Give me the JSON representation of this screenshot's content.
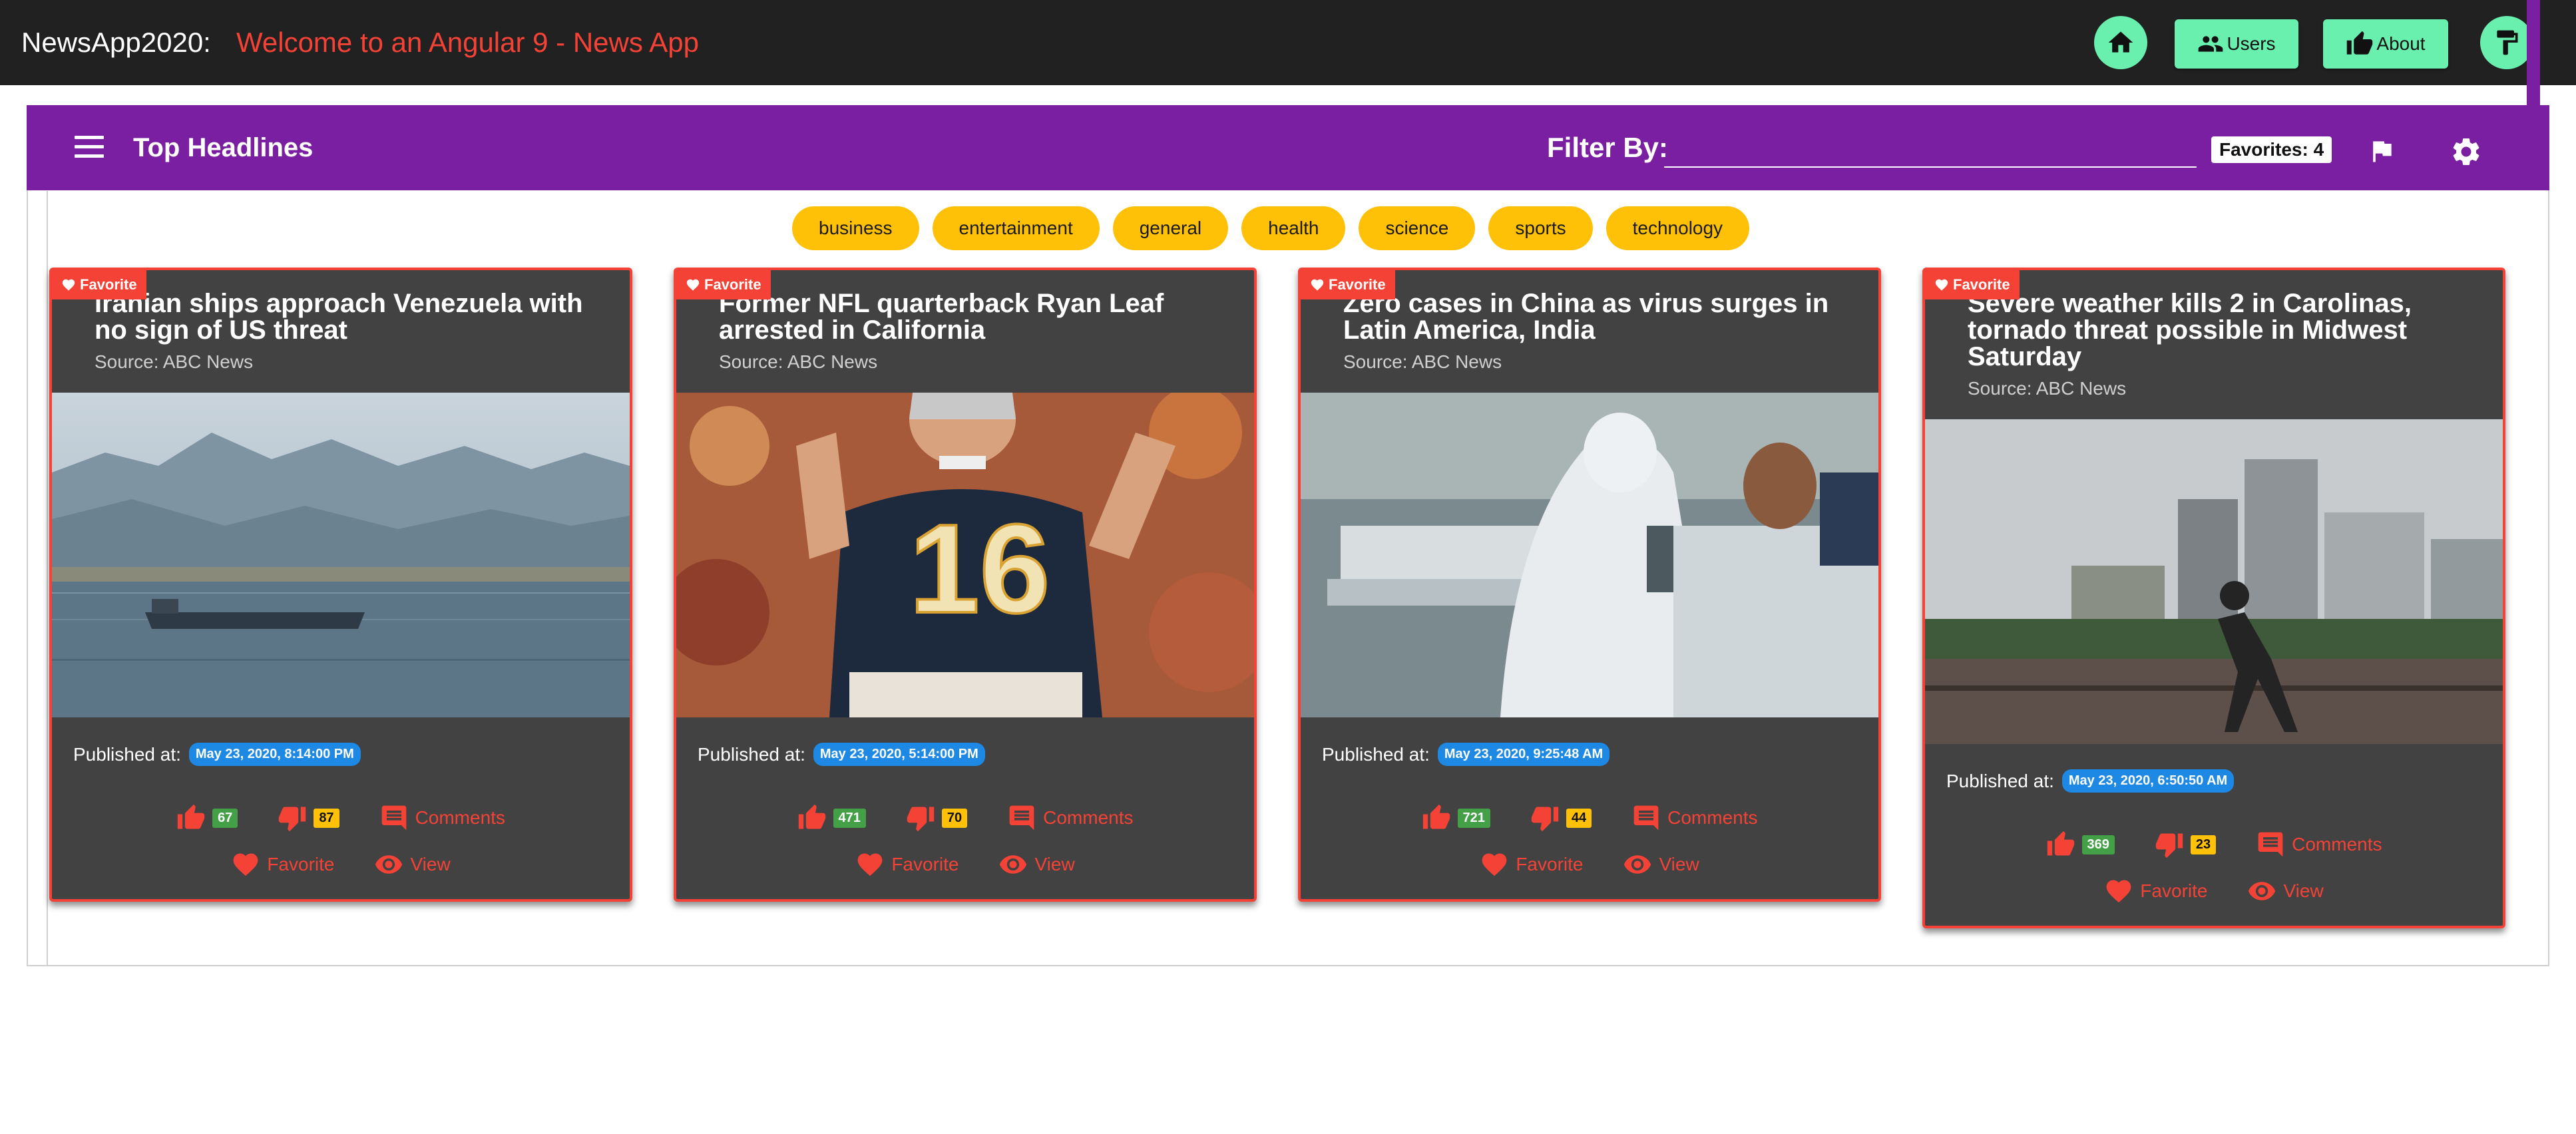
{
  "app": {
    "brand": "NewsApp2020:",
    "welcome": "Welcome to an Angular 9 - News App",
    "nav": {
      "users": "Users",
      "about": "About"
    },
    "colors": {
      "toolbar": "#212121",
      "accent": "#69f0ae",
      "primary": "#7b1fa2",
      "warn": "#f44336",
      "chip": "#ffc107"
    }
  },
  "header": {
    "title": "Top Headlines",
    "filter_label": "Filter By:",
    "filter_value": "",
    "favorites": "Favorites: 4"
  },
  "categories": [
    "business",
    "entertainment",
    "general",
    "health",
    "science",
    "sports",
    "technology"
  ],
  "labels": {
    "favorite_badge": "Favorite",
    "published": "Published at:",
    "comments": "Comments",
    "favorite": "Favorite",
    "view": "View"
  },
  "articles": [
    {
      "title": "Iranian ships approach Venezuela with no sign of US threat",
      "source": "Source: ABC News",
      "published": "May 23, 2020, 8:14:00 PM",
      "likes": "67",
      "dislikes": "87"
    },
    {
      "title": "Former NFL quarterback Ryan Leaf arrested in California",
      "source": "Source: ABC News",
      "published": "May 23, 2020, 5:14:00 PM",
      "likes": "471",
      "dislikes": "70"
    },
    {
      "title": "Zero cases in China as virus surges in Latin America, India",
      "source": "Source: ABC News",
      "published": "May 23, 2020, 9:25:48 AM",
      "likes": "721",
      "dislikes": "44"
    },
    {
      "title": "Severe weather kills 2 in Carolinas, tornado threat possible in Midwest Saturday",
      "source": "Source: ABC News",
      "published": "May 23, 2020, 6:50:50 AM",
      "likes": "369",
      "dislikes": "23"
    }
  ]
}
